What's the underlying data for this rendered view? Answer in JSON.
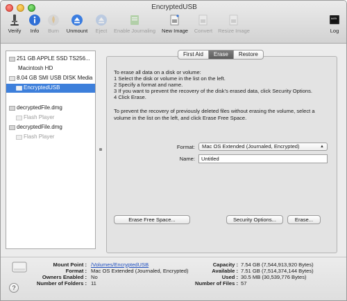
{
  "window": {
    "title": "EncryptedUSB"
  },
  "toolbar": {
    "verify": "Verify",
    "info": "Info",
    "burn": "Burn",
    "unmount": "Unmount",
    "eject": "Eject",
    "enable_journaling": "Enable Journaling",
    "new_image": "New Image",
    "convert": "Convert",
    "resize_image": "Resize Image",
    "log": "Log",
    "log_text": "WARN\n7:36"
  },
  "sidebar": {
    "items": [
      {
        "label": "251 GB APPLE SSD TS256...",
        "kind": "disk"
      },
      {
        "label": "Macintosh HD",
        "kind": "volume"
      },
      {
        "label": "8.04 GB SMI USB DISK Media",
        "kind": "disk"
      },
      {
        "label": "EncryptedUSB",
        "kind": "volume",
        "selected": true
      },
      {
        "label": "decryptedFile.dmg",
        "kind": "image"
      },
      {
        "label": "Flash Player",
        "kind": "volume",
        "dimmed": true
      },
      {
        "label": "decryptedFile.dmg",
        "kind": "image"
      },
      {
        "label": "Flash Player",
        "kind": "volume",
        "dimmed": true
      }
    ]
  },
  "tabs": {
    "first_aid": "First Aid",
    "erase": "Erase",
    "restore": "Restore",
    "active": "Erase"
  },
  "erase": {
    "instructions": [
      "To erase all data on a disk or volume:",
      "1  Select the disk or volume in the list on the left.",
      "2  Specify a format and name.",
      "3  If you want to prevent the recovery of the disk’s erased data, click Security Options.",
      "4  Click Erase."
    ],
    "free_space_instructions": "To prevent the recovery of previously deleted files without erasing the volume, select a volume in the list on the left, and click Erase Free Space.",
    "format_label": "Format:",
    "format_value": "Mac OS Extended (Journaled, Encrypted)",
    "name_label": "Name:",
    "name_value": "Untitled",
    "erase_free_space_button": "Erase Free Space...",
    "security_options_button": "Security Options...",
    "erase_button": "Erase..."
  },
  "info": {
    "mount_point_label": "Mount Point :",
    "mount_point_value": "/Volumes/EncryptedUSB",
    "format_label": "Format :",
    "format_value": "Mac OS Extended (Journaled, Encrypted)",
    "owners_enabled_label": "Owners Enabled :",
    "owners_enabled_value": "No",
    "number_of_folders_label": "Number of Folders :",
    "number_of_folders_value": "11",
    "capacity_label": "Capacity :",
    "capacity_value": "7.54 GB (7,544,913,920 Bytes)",
    "available_label": "Available :",
    "available_value": "7.51 GB (7,514,374,144 Bytes)",
    "used_label": "Used :",
    "used_value": "30.5 MB (30,539,776 Bytes)",
    "number_of_files_label": "Number of Files :",
    "number_of_files_value": "57",
    "help_label": "?"
  }
}
